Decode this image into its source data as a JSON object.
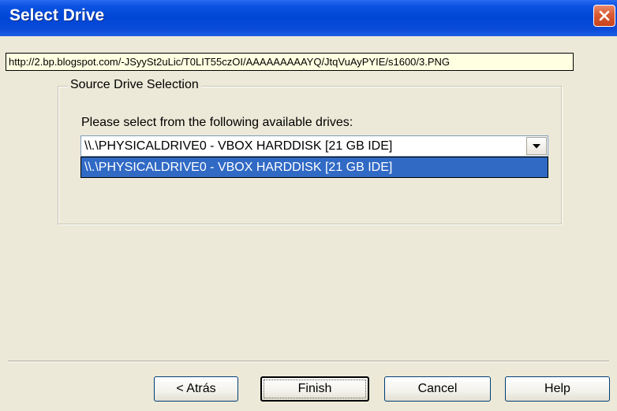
{
  "window": {
    "title": "Select Drive",
    "close_icon": "close-icon"
  },
  "tooltip": {
    "text": "http://2.bp.blogspot.com/-JSyySt2uLic/T0LIT55czOI/AAAAAAAAAYQ/JtqVuAyPYIE/s1600/3.PNG"
  },
  "group": {
    "legend": "Source Drive Selection",
    "instruction": "Please select from the following available drives:"
  },
  "drive_select": {
    "selected_value": "\\\\.\\PHYSICALDRIVE0 - VBOX HARDDISK [21 GB IDE]",
    "options": [
      "\\\\.\\PHYSICALDRIVE0 - VBOX HARDDISK [21 GB IDE]"
    ],
    "arrow_icon": "chevron-down-icon"
  },
  "buttons": {
    "back": "< Atrás",
    "finish": "Finish",
    "cancel": "Cancel",
    "help": "Help"
  },
  "colors": {
    "titlebar": "#0a4bd8",
    "selection": "#316ac5",
    "close": "#d95a34",
    "dialog_bg": "#ece9d8"
  }
}
